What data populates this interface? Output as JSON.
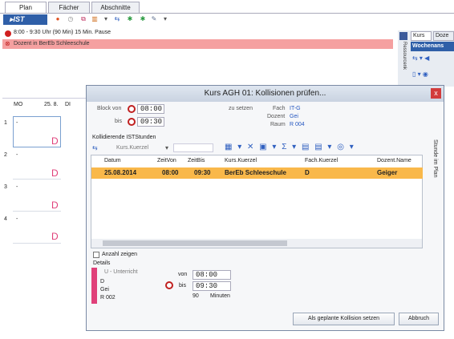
{
  "tabs": [
    "Plan",
    "Fächer",
    "Abschnitte"
  ],
  "toolbar": {
    "ist_label": "▸IST"
  },
  "info_line": "8:00 - 9:30 Uhr (90 Min) 15 Min. Pause",
  "alert_line": "Dozent in BerEb Schleeschule",
  "right_panel": {
    "tabs": [
      "Kurs",
      "Doze"
    ],
    "vertical_label": "Ressourcenk",
    "header": "Wochenans"
  },
  "calendar": {
    "day_label": "MO",
    "date_label": "25. 8.",
    "next_day": "DI",
    "rows": [
      "1",
      "2",
      "3",
      "4"
    ],
    "dash": "-",
    "d": "D"
  },
  "dialog": {
    "title": "Kurs AGH 01: Kollisionen prüfen...",
    "close": "x",
    "block_von_label": "Block von",
    "block_von": "08:00",
    "bis_label": "bis",
    "bis": "09:30",
    "zu_setzen": "zu setzen",
    "fach_label": "Fach",
    "fach": "IT-G",
    "dozent_label": "Dozent",
    "dozent": "Gei",
    "raum_label": "Raum",
    "raum": "R 004",
    "section": "Kollidierende ISTStunden",
    "filter": "Kurs.Kuerzel",
    "side_label": "Stunde im Plan",
    "columns": [
      "Datum",
      "ZeitVon",
      "ZeitBis",
      "Kurs.Kuerzel",
      "Fach.Kuerzel",
      "Dozent.Name"
    ],
    "rows": [
      [
        "25.08.2014",
        "08:00",
        "09:30",
        "BerEb Schleeschule",
        "D",
        "Geiger"
      ]
    ],
    "anzahl": "Anzahl zeigen",
    "details": "Details",
    "detail_type": "U - Unterricht",
    "detail_items": [
      "D",
      "Gei",
      "R 002"
    ],
    "von_label": "von",
    "von": "08:00",
    "bis2_label": "bis",
    "bis2": "09:30",
    "minutes": "90",
    "minutes_label": "Minuten",
    "btn_planned": "Als geplante Kollision setzen",
    "btn_cancel": "Abbruch"
  }
}
